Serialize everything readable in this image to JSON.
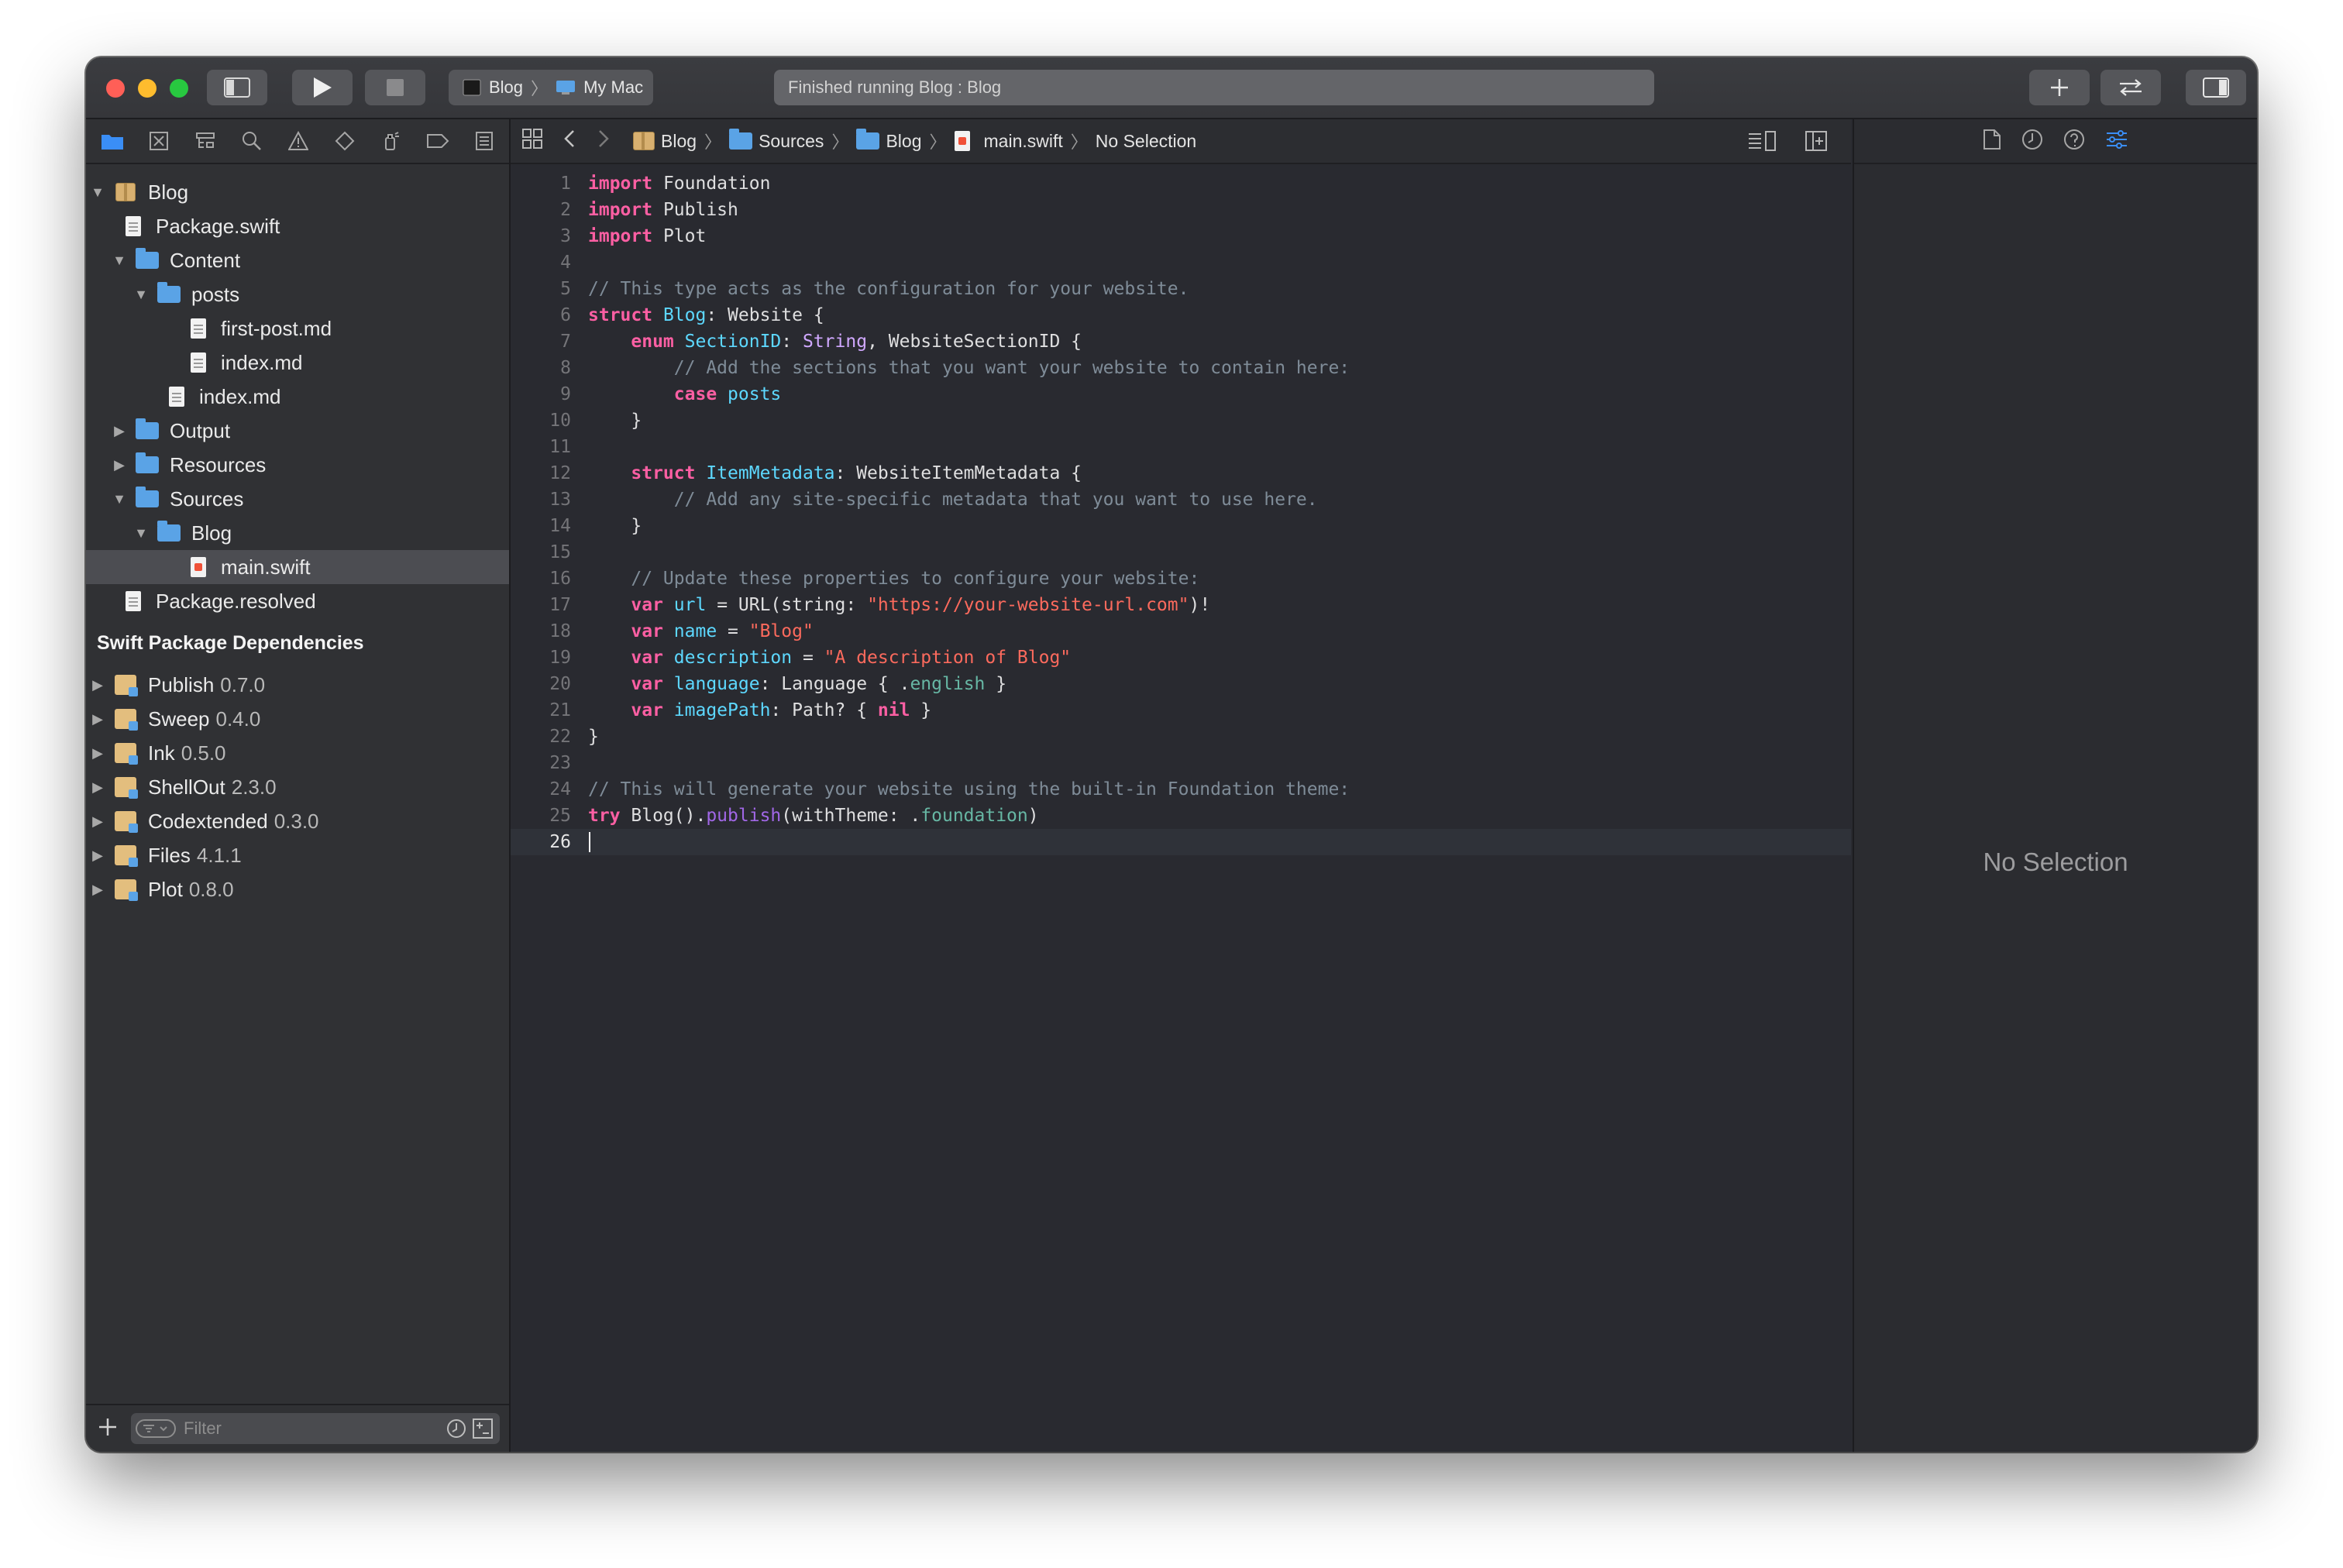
{
  "toolbar": {
    "scheme_target": "Blog",
    "scheme_device": "My Mac",
    "activity_status": "Finished running Blog : Blog"
  },
  "navigator": {
    "tree": [
      {
        "label": "Blog",
        "icon": "project-icon",
        "disclosure": "open"
      },
      {
        "label": "Package.swift",
        "icon": "document-icon",
        "disclosure": "none"
      },
      {
        "label": "Content",
        "icon": "folder-icon",
        "disclosure": "open"
      },
      {
        "label": "posts",
        "icon": "folder-icon",
        "disclosure": "open"
      },
      {
        "label": "first-post.md",
        "icon": "document-icon",
        "disclosure": "none"
      },
      {
        "label": "index.md",
        "icon": "document-icon",
        "disclosure": "none"
      },
      {
        "label": "index.md",
        "icon": "document-icon",
        "disclosure": "none"
      },
      {
        "label": "Output",
        "icon": "folder-icon",
        "disclosure": "closed"
      },
      {
        "label": "Resources",
        "icon": "folder-icon",
        "disclosure": "closed"
      },
      {
        "label": "Sources",
        "icon": "folder-icon",
        "disclosure": "open"
      },
      {
        "label": "Blog",
        "icon": "folder-icon",
        "disclosure": "open"
      },
      {
        "label": "main.swift",
        "icon": "swift-file-icon",
        "disclosure": "none",
        "selected": true
      },
      {
        "label": "Package.resolved",
        "icon": "document-icon",
        "disclosure": "none"
      }
    ],
    "dependencies_header": "Swift Package Dependencies",
    "dependencies": [
      {
        "name": "Publish",
        "version": "0.7.0"
      },
      {
        "name": "Sweep",
        "version": "0.4.0"
      },
      {
        "name": "Ink",
        "version": "0.5.0"
      },
      {
        "name": "ShellOut",
        "version": "2.3.0"
      },
      {
        "name": "Codextended",
        "version": "0.3.0"
      },
      {
        "name": "Files",
        "version": "4.1.1"
      },
      {
        "name": "Plot",
        "version": "0.8.0"
      }
    ],
    "filter_placeholder": "Filter"
  },
  "jumpbar": {
    "crumbs": [
      "Blog",
      "Sources",
      "Blog",
      "main.swift",
      "No Selection"
    ]
  },
  "editor": {
    "current_line": 26,
    "lines": [
      [
        [
          "kw",
          "import"
        ],
        [
          "plain",
          " Foundation"
        ]
      ],
      [
        [
          "kw",
          "import"
        ],
        [
          "plain",
          " Publish"
        ]
      ],
      [
        [
          "kw",
          "import"
        ],
        [
          "plain",
          " Plot"
        ]
      ],
      [],
      [
        [
          "cm",
          "// This type acts as the configuration for your website."
        ]
      ],
      [
        [
          "kw",
          "struct"
        ],
        [
          "plain",
          " "
        ],
        [
          "ty",
          "Blog"
        ],
        [
          "plain",
          ": Website {"
        ]
      ],
      [
        [
          "plain",
          "    "
        ],
        [
          "kw",
          "enum"
        ],
        [
          "plain",
          " "
        ],
        [
          "ty",
          "SectionID"
        ],
        [
          "plain",
          ": "
        ],
        [
          "sys",
          "String"
        ],
        [
          "plain",
          ", WebsiteSectionID {"
        ]
      ],
      [
        [
          "cm",
          "        // Add the sections that you want your website to contain here:"
        ]
      ],
      [
        [
          "plain",
          "        "
        ],
        [
          "kw",
          "case"
        ],
        [
          "plain",
          " "
        ],
        [
          "ty",
          "posts"
        ]
      ],
      [
        [
          "plain",
          "    }"
        ]
      ],
      [],
      [
        [
          "plain",
          "    "
        ],
        [
          "kw",
          "struct"
        ],
        [
          "plain",
          " "
        ],
        [
          "ty",
          "ItemMetadata"
        ],
        [
          "plain",
          ": WebsiteItemMetadata {"
        ]
      ],
      [
        [
          "cm",
          "        // Add any site-specific metadata that you want to use here."
        ]
      ],
      [
        [
          "plain",
          "    }"
        ]
      ],
      [],
      [
        [
          "cm",
          "    // Update these properties to configure your website:"
        ]
      ],
      [
        [
          "plain",
          "    "
        ],
        [
          "kw",
          "var"
        ],
        [
          "plain",
          " "
        ],
        [
          "ty",
          "url"
        ],
        [
          "plain",
          " = URL(string: "
        ],
        [
          "str",
          "\"https://your-website-url.com\""
        ],
        [
          "plain",
          ")!"
        ]
      ],
      [
        [
          "plain",
          "    "
        ],
        [
          "kw",
          "var"
        ],
        [
          "plain",
          " "
        ],
        [
          "ty",
          "name"
        ],
        [
          "plain",
          " = "
        ],
        [
          "str",
          "\"Blog\""
        ]
      ],
      [
        [
          "plain",
          "    "
        ],
        [
          "kw",
          "var"
        ],
        [
          "plain",
          " "
        ],
        [
          "ty",
          "description"
        ],
        [
          "plain",
          " = "
        ],
        [
          "str",
          "\"A description of Blog\""
        ]
      ],
      [
        [
          "plain",
          "    "
        ],
        [
          "kw",
          "var"
        ],
        [
          "plain",
          " "
        ],
        [
          "ty",
          "language"
        ],
        [
          "plain",
          ": Language { ."
        ],
        [
          "prop",
          "english"
        ],
        [
          "plain",
          " }"
        ]
      ],
      [
        [
          "plain",
          "    "
        ],
        [
          "kw",
          "var"
        ],
        [
          "plain",
          " "
        ],
        [
          "ty",
          "imagePath"
        ],
        [
          "plain",
          ": Path? { "
        ],
        [
          "kw",
          "nil"
        ],
        [
          "plain",
          " }"
        ]
      ],
      [
        [
          "plain",
          "}"
        ]
      ],
      [],
      [
        [
          "cm",
          "// This will generate your website using the built-in Foundation theme:"
        ]
      ],
      [
        [
          "kw",
          "try"
        ],
        [
          "plain",
          " Blog()."
        ],
        [
          "fn",
          "publish"
        ],
        [
          "plain",
          "(withTheme: ."
        ],
        [
          "prop",
          "foundation"
        ],
        [
          "plain",
          ")"
        ]
      ],
      []
    ]
  },
  "inspector": {
    "empty_label": "No Selection"
  },
  "colors": {
    "traffic_close": "#ff5f57",
    "traffic_minimize": "#febc2e",
    "traffic_zoom": "#28c840",
    "accent_blue": "#3a8ef6",
    "keyword": "#fc5fa3",
    "type": "#5dd8ff",
    "comment": "#7f8c98",
    "string": "#fc6a5d"
  }
}
